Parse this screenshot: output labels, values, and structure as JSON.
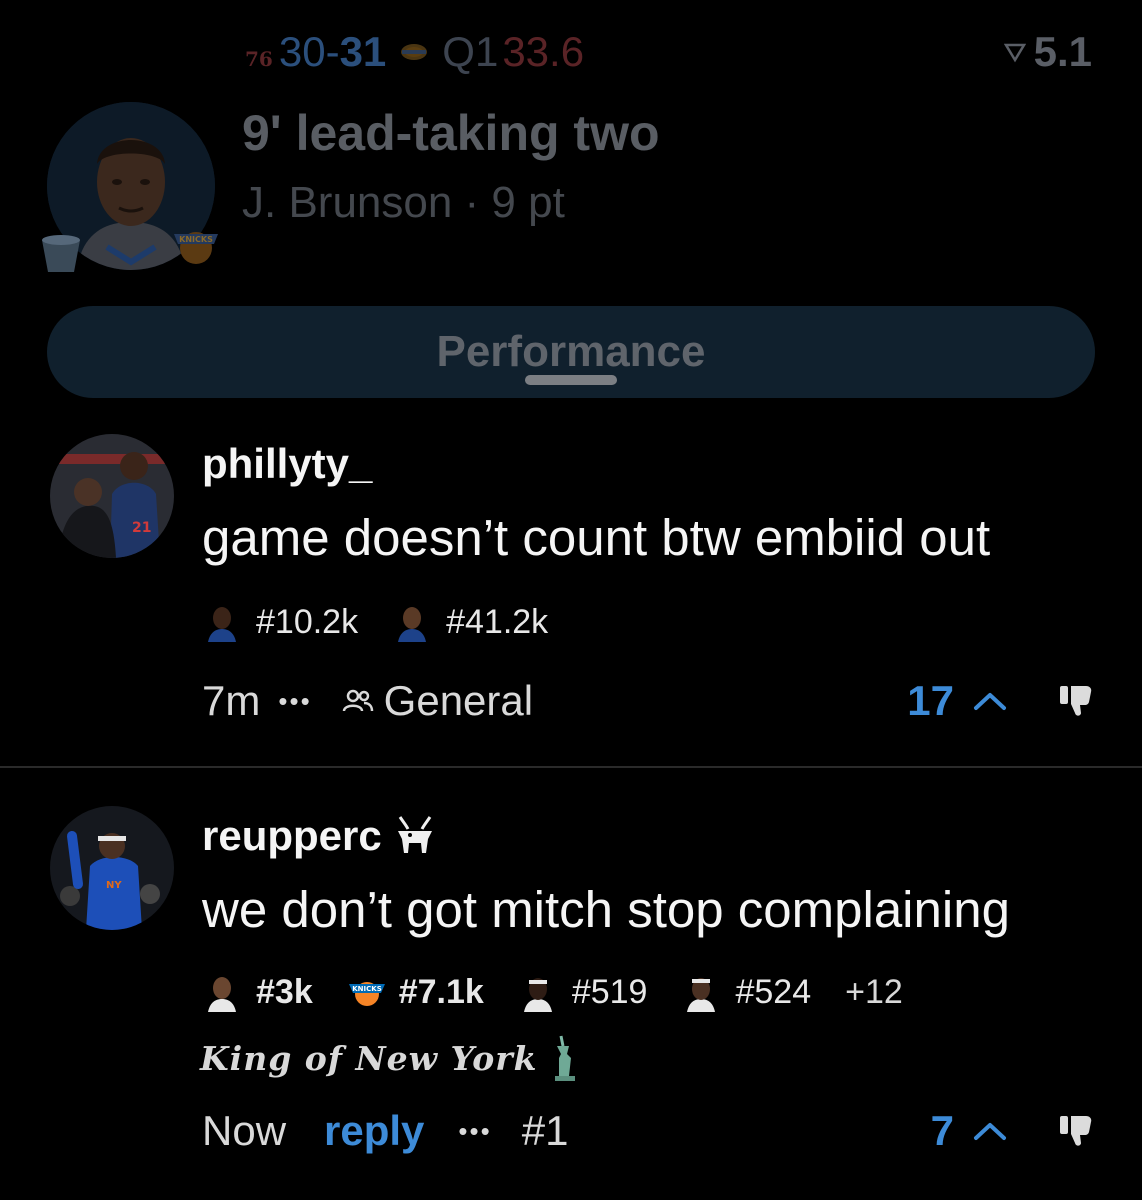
{
  "scoreboard": {
    "away_logo": "76",
    "away_score": "30",
    "separator": "-",
    "home_score": "31",
    "period": "Q1",
    "clock": "33.6",
    "signal_value": "5.1",
    "colors": {
      "score": "#2b4f7c",
      "clock": "#5a2326",
      "dim_text": "#595d63"
    }
  },
  "play": {
    "title": "9' lead-taking two",
    "subtitle": "J. Brunson · 9 pt"
  },
  "performance_button": {
    "label": "Performance",
    "bg": "#10202d"
  },
  "comments": [
    {
      "username": "phillyty_",
      "body": "game doesn’t count btw embiid out",
      "badges": [
        "#10.2k",
        "#41.2k"
      ],
      "time": "7m",
      "more": "•••",
      "channel": "General",
      "votes": "17"
    },
    {
      "username": "reupperc",
      "username_icon": "goat-icon",
      "body": "we don’t got mitch stop complaining",
      "badges": [
        "#3k",
        "#7.1k",
        "#519",
        "#524"
      ],
      "extra_badges": "+12",
      "user_title": "King of New York",
      "time": "Now",
      "reply_label": "reply",
      "more": "•••",
      "rank": "#1",
      "votes": "7"
    }
  ],
  "accent_color": "#3d8bd8"
}
